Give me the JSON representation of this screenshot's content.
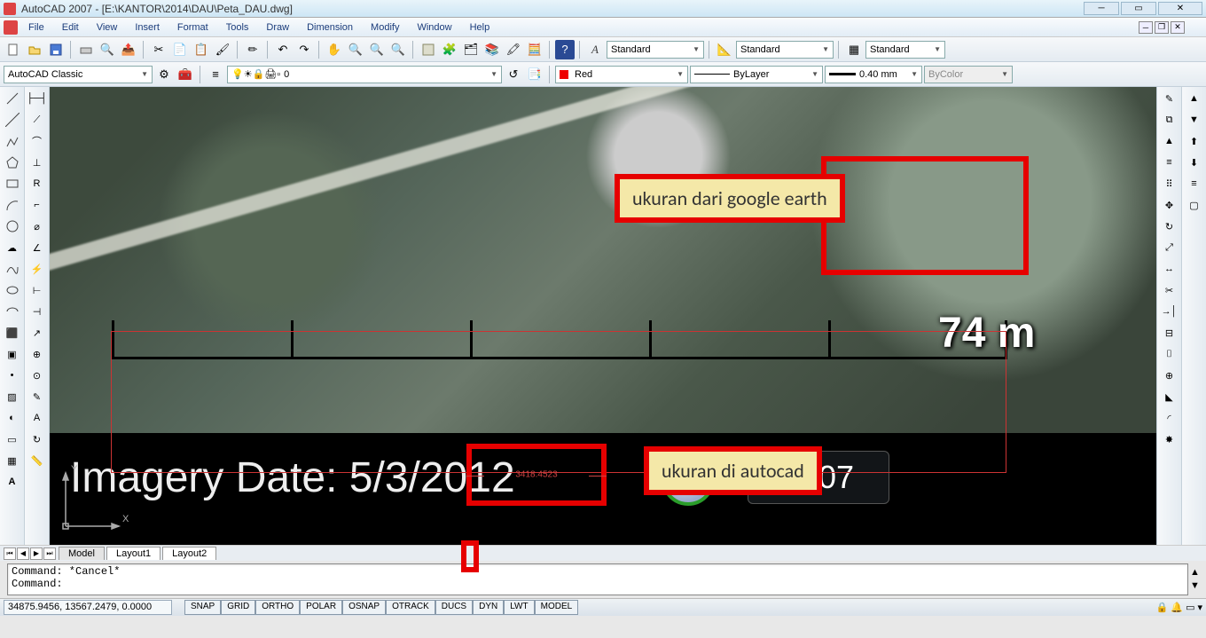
{
  "title": "AutoCAD 2007 - [E:\\KANTOR\\2014\\DAU\\Peta_DAU.dwg]",
  "menus": [
    "File",
    "Edit",
    "View",
    "Insert",
    "Format",
    "Tools",
    "Draw",
    "Dimension",
    "Modify",
    "Window",
    "Help"
  ],
  "textstyle_combo": "Standard",
  "dimstyle_combo": "Standard",
  "tablestyle_combo": "Standard",
  "workspace_combo": "AutoCAD Classic",
  "layer_combo": "0",
  "color_combo": "Red",
  "linetype_combo": "ByLayer",
  "lineweight_combo": "0.40 mm",
  "plotstyle_combo": "ByColor",
  "annotation1": "ukuran dari google earth",
  "annotation2": "ukuran di autocad",
  "ge_distance": "74 m",
  "imagery_label": "Imagery Date: 5/3/2012",
  "history_year": "2007",
  "acad_dim": "3418.4523",
  "ucs_y": "Y",
  "ucs_x": "X",
  "tabs": {
    "t1": "Model",
    "t2": "Layout1",
    "t3": "Layout2"
  },
  "cmd_line1": "Command: *Cancel*",
  "cmd_line2": "Command:",
  "coords": "34875.9456, 13567.2479, 0.0000",
  "status_buttons": [
    "SNAP",
    "GRID",
    "ORTHO",
    "POLAR",
    "OSNAP",
    "OTRACK",
    "DUCS",
    "DYN",
    "LWT",
    "MODEL"
  ]
}
